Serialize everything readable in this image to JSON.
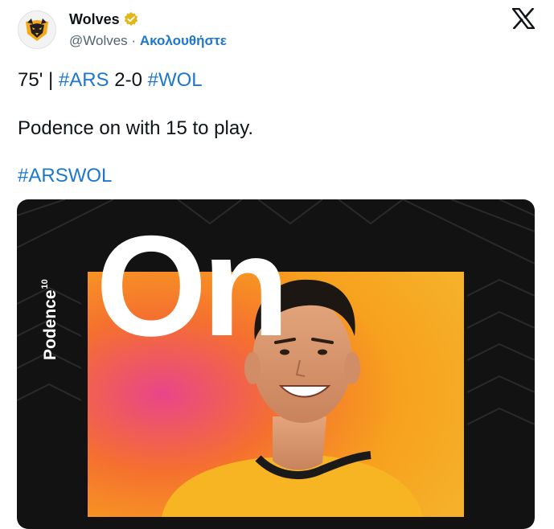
{
  "account": {
    "name": "Wolves",
    "handle": "@Wolves",
    "separator": "·",
    "follow_label": "Ακολουθήστε"
  },
  "tweet": {
    "minute": "75'",
    "divider": "|",
    "home_tag": "#ARS",
    "score": "2-0",
    "away_tag": "#WOL",
    "body": "Podence on with 15 to play.",
    "hashtag": "#ARSWOL"
  },
  "media": {
    "headline": "On",
    "player_name": "Podence",
    "shirt_number": "10"
  },
  "colors": {
    "link": "#1d77d1",
    "verified_badge": "#e2b719",
    "media_background": "#121212",
    "gradient_orange": "#f7a21e",
    "gradient_pink": "#e9458a",
    "shirt_gold": "#f7b523"
  },
  "icons": [
    "wolves-logo-icon",
    "verified-badge-icon",
    "x-logo-icon"
  ]
}
